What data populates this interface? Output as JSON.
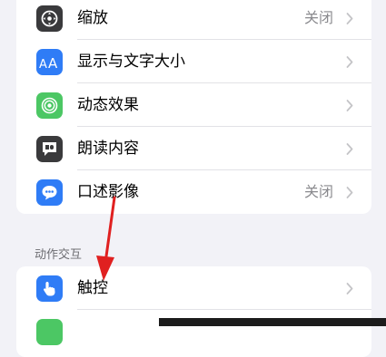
{
  "vision_group": {
    "rows": [
      {
        "label": "缩放",
        "value": "关闭",
        "icon": "zoom-icon",
        "color": "#3a3a3c"
      },
      {
        "label": "显示与文字大小",
        "value": "",
        "icon": "text-size-icon",
        "color": "#2f7cf6"
      },
      {
        "label": "动态效果",
        "value": "",
        "icon": "motion-icon",
        "color": "#4cc764"
      },
      {
        "label": "朗读内容",
        "value": "",
        "icon": "spoken-content-icon",
        "color": "#3a3a3c"
      },
      {
        "label": "口述影像",
        "value": "关闭",
        "icon": "audio-description-icon",
        "color": "#2f7cf6"
      }
    ]
  },
  "interaction_section": {
    "header": "动作交互",
    "rows": [
      {
        "label": "触控",
        "icon": "touch-icon",
        "color": "#2f7cf6"
      }
    ]
  },
  "annotation": {
    "arrow_color": "#e02020"
  }
}
